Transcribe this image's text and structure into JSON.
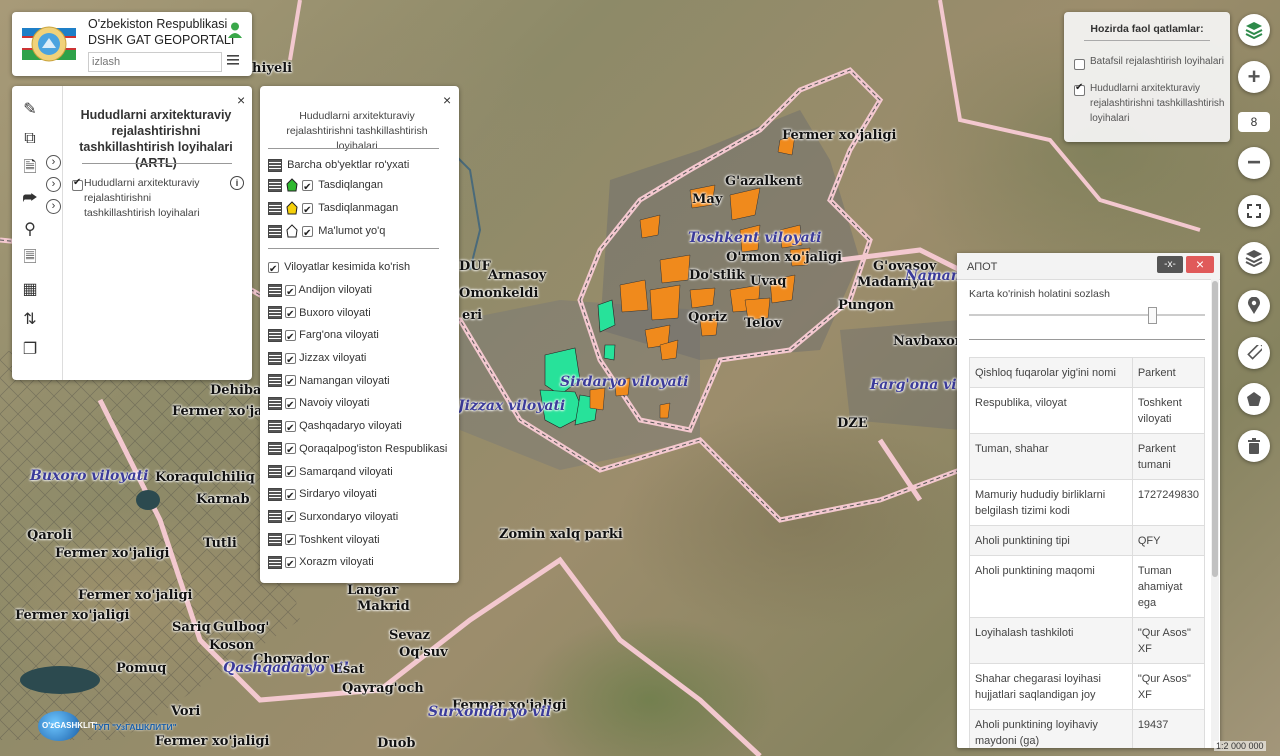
{
  "header": {
    "title_line1": "O'zbekiston Respublikasi",
    "title_line2": "DSHK GAT GEOPORTALI",
    "search_placeholder": "izlash",
    "menu_icon": "hamburger-icon",
    "user_icon": "user-icon"
  },
  "left_toolbar": {
    "icons": [
      "edit-icon",
      "copy-icon",
      "document-icon",
      "export-icon",
      "location-pin-icon",
      "file-icon",
      "building-icon",
      "sort-icon",
      "duplicate-icon"
    ]
  },
  "artl_panel": {
    "title": "Hududlarni arxitekturaviy rejalashtirishni tashkillashtirish loyihalari (ARTL)",
    "layer_label": "Hududlarni arxitekturaviy rejalashtirishni tashkillashtirish loyihalari",
    "close": "×",
    "arrows": [
      "›",
      "›",
      "›"
    ]
  },
  "legend_panel": {
    "title": "Hududlarni arxitekturaviy rejalashtirishni tashkillashtirish loyihalari",
    "close": "×",
    "all_objects": "Barcha ob'yektlar ro'yxati",
    "statuses": [
      {
        "label": "Tasdiqlangan",
        "color": "#2eb82e"
      },
      {
        "label": "Tasdiqlanmagan",
        "color": "#f5d00a"
      },
      {
        "label": "Ma'lumot yo'q",
        "color": "#ffffff"
      }
    ],
    "by_region": "Viloyatlar kesimida ko'rish",
    "regions": [
      "Andijon viloyati",
      "Buxoro viloyati",
      "Farg'ona viloyati",
      "Jizzax viloyati",
      "Namangan viloyati",
      "Navoiy viloyati",
      "Qashqadaryo viloyati",
      "Qoraqalpog'iston Respublikasi",
      "Samarqand viloyati",
      "Sirdaryo viloyati",
      "Surxondaryo viloyati",
      "Toshkent viloyati",
      "Xorazm viloyati"
    ]
  },
  "active_layers": {
    "title": "Hozirda faol qatlamlar:",
    "items": [
      {
        "label": "Batafsil rejalashtirish loyihalari",
        "checked": false
      },
      {
        "label": "Hududlarni arxitekturaviy rejalashtirishni tashkillashtirish loyihalari",
        "checked": true
      }
    ]
  },
  "map_controls": {
    "zoom_level": "8",
    "icons": [
      "layers-green-icon",
      "zoom-in-icon",
      "zoom-out-icon",
      "fullscreen-icon",
      "layers-icon",
      "location-pin-icon",
      "ruler-icon",
      "polygon-icon",
      "trash-icon"
    ]
  },
  "info_panel": {
    "title": "АПОТ",
    "minimize": "-x-",
    "close": "×",
    "opacity_label": "Karta ko'rinish holatini sozlash",
    "opacity_value": 0.79,
    "rows": [
      {
        "key": "Qishloq fuqarolar yig'ini nomi",
        "value": "Parkent"
      },
      {
        "key": "Respublika, viloyat",
        "value": "Toshkent viloyati"
      },
      {
        "key": "Tuman, shahar",
        "value": "Parkent tumani"
      },
      {
        "key": "Mamuriy hududiy birliklarni belgilash tizimi kodi",
        "value": "1727249830"
      },
      {
        "key": "Aholi punktining tipi",
        "value": "QFY"
      },
      {
        "key": "Aholi punktining maqomi",
        "value": "Tuman ahamiyat ega"
      },
      {
        "key": "Loyihalash tashkiloti",
        "value": "\"Qur Asos\" XF"
      },
      {
        "key": "Shahar chegarasi loyihasi hujjatlari saqlandigan joy",
        "value": "\"Qur Asos\" XF"
      },
      {
        "key": "Aholi punktining loyihaviy maydoni (ga)",
        "value": "19437"
      }
    ]
  },
  "footer": {
    "logo_text": "O'zGASHKLITI",
    "logo_sub": "ТУП \"УзГАШКЛИТИ\"",
    "scale": "1:2 000 000"
  },
  "map_labels": {
    "fermer_1": "Fermer xo'jaligi",
    "gazalkent": "G'azalkent",
    "may": "May",
    "toshkent_vil": "Toshkent viloyati",
    "ormon": "O'rmon xo'jaligi",
    "dostlik": "Do'stlik",
    "uvaq": "Uvaq",
    "qoriz": "Qoriz",
    "telov": "Telov",
    "govasoy": "G'ovasoy",
    "madaniyat": "Madaniyat",
    "namangan_vil": "Namangan vil",
    "pungon": "Pungon",
    "navbaxor": "Navbaxor",
    "fargona_vil": "Farg'ona vil",
    "dze": "DZE",
    "arnasoy": "Arnasoy",
    "omonkeldi": "Omonkeldi",
    "duf": "DUF",
    "eri": "eri",
    "sirdaryo_vil": "Sirdaryo viloyati",
    "jizzax_vil": "Jizzax viloyati",
    "dehibala": "Dehibala",
    "fermer_2": "Fermer xo'jaligi",
    "buxoro_vil": "Buxoro viloyati",
    "koraqulchiliq": "Koraqulchiliq",
    "karnab": "Karnab",
    "qaroli": "Qaroli",
    "tutli": "Tutli",
    "fermer_3": "Fermer xo'jaligi",
    "fermer_4": "Fermer xo'jaligi",
    "fermer_5": "Fermer xo'jaligi",
    "zomin": "Zomin xalq parki",
    "langar": "Langar",
    "makrid": "Makrid",
    "sariq": "Sariq",
    "gulbog": "Gulbog'",
    "koson": "Koson",
    "sevaz": "Sevaz",
    "oqsuv": "Oq'suv",
    "chorvador": "Chorvador",
    "qashqadaryo_vil": "Qashqadaryo vil",
    "esat": "Esat",
    "pomuq": "Pomuq",
    "qayragoch": "Qayrag'och",
    "fermer_6": "Fermer xo'jaligi",
    "surxondaryo_vil": "Surxondaryo vil",
    "vori": "Vori",
    "fermer_7": "Fermer xo'jaligi",
    "duob": "Duob",
    "hiyeli": "hiyeli"
  }
}
